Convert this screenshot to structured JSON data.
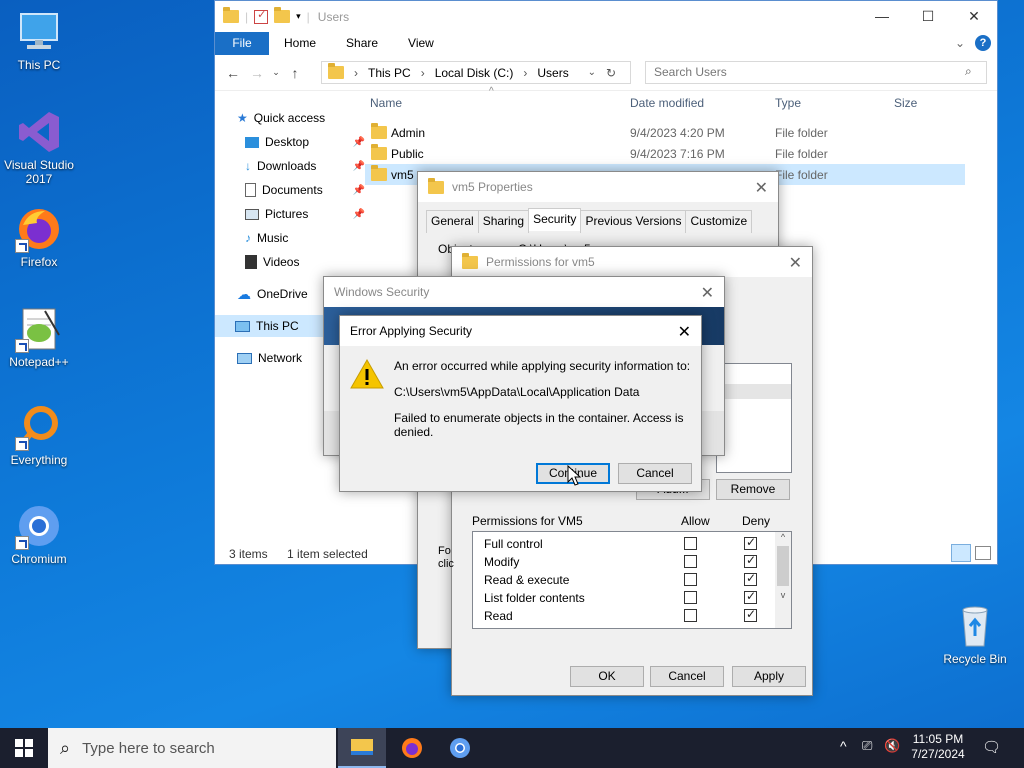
{
  "desktop": {
    "icons": [
      {
        "label": "This PC"
      },
      {
        "label": "Visual Studio\n2017"
      },
      {
        "label": "Firefox"
      },
      {
        "label": "Notepad++"
      },
      {
        "label": "Everything"
      },
      {
        "label": "Chromium"
      },
      {
        "label": "Recycle Bin"
      }
    ]
  },
  "explorer": {
    "title": "Users",
    "ribbon": {
      "file": "File",
      "tabs": [
        "Home",
        "Share",
        "View"
      ]
    },
    "address": [
      "This PC",
      "Local Disk (C:)",
      "Users"
    ],
    "search_placeholder": "Search Users",
    "nav": [
      {
        "label": "Quick access"
      },
      {
        "label": "Desktop"
      },
      {
        "label": "Downloads"
      },
      {
        "label": "Documents"
      },
      {
        "label": "Pictures"
      },
      {
        "label": "Music"
      },
      {
        "label": "Videos"
      },
      {
        "label": "OneDrive"
      },
      {
        "label": "This PC"
      },
      {
        "label": "Network"
      }
    ],
    "columns": [
      "Name",
      "Date modified",
      "Type",
      "Size"
    ],
    "rows": [
      {
        "name": "Admin",
        "date": "9/4/2023 4:20 PM",
        "type": "File folder"
      },
      {
        "name": "Public",
        "date": "9/4/2023 7:16 PM",
        "type": "File folder"
      },
      {
        "name": "vm5",
        "date": "",
        "type": "File folder"
      }
    ],
    "status_items": "3 items",
    "status_selected": "1 item selected"
  },
  "props": {
    "title": "vm5 Properties",
    "tabs": [
      "General",
      "Sharing",
      "Security",
      "Previous Versions",
      "Customize"
    ],
    "object_name_label": "Object name:",
    "object_name_value": "C:\\Users\\vm5"
  },
  "perms": {
    "title": "Permissions for vm5",
    "remove": "Remove",
    "add": "Add...",
    "header": "Permissions for VM5",
    "allow": "Allow",
    "deny": "Deny",
    "rows": [
      {
        "label": "Full control",
        "allow": false,
        "deny": true
      },
      {
        "label": "Modify",
        "allow": false,
        "deny": true
      },
      {
        "label": "Read & execute",
        "allow": false,
        "deny": true
      },
      {
        "label": "List folder contents",
        "allow": false,
        "deny": true
      },
      {
        "label": "Read",
        "allow": false,
        "deny": true
      }
    ],
    "ok": "OK",
    "cancel": "Cancel",
    "apply": "Apply",
    "behind_text_1": "Fo",
    "behind_text_2": "clic"
  },
  "winsec": {
    "title": "Windows Security"
  },
  "error": {
    "title": "Error Applying Security",
    "line1": "An error occurred while applying security information to:",
    "path": "C:\\Users\\vm5\\AppData\\Local\\Application Data",
    "line2": "Failed to enumerate objects in the container. Access is denied.",
    "continue": "Continue",
    "cancel": "Cancel"
  },
  "taskbar": {
    "search": "Type here to search",
    "time": "11:05 PM",
    "date": "7/27/2024"
  }
}
